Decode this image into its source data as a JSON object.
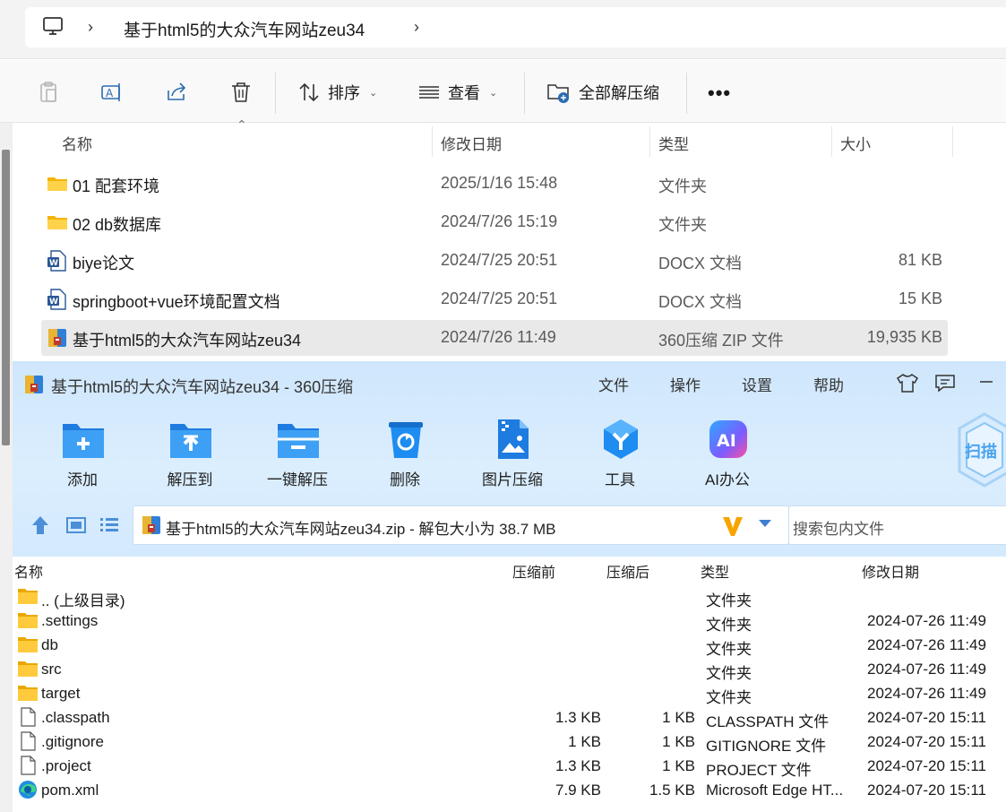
{
  "explorer": {
    "breadcrumb": {
      "computer_icon": "computer-icon",
      "path": "基于html5的大众汽车网站zeu34"
    },
    "toolbar": {
      "sort_label": "排序",
      "view_label": "查看",
      "extract_all_label": "全部解压缩"
    },
    "columns": {
      "name": "名称",
      "modified": "修改日期",
      "type": "类型",
      "size": "大小"
    },
    "files": [
      {
        "icon": "folder-icon",
        "name": "01 配套环境",
        "modified": "2025/1/16 15:48",
        "type": "文件夹",
        "size": ""
      },
      {
        "icon": "folder-icon",
        "name": "02 db数据库",
        "modified": "2024/7/26 15:19",
        "type": "文件夹",
        "size": ""
      },
      {
        "icon": "word-doc-icon",
        "name": "biye论文",
        "modified": "2024/7/25 20:51",
        "type": "DOCX 文档",
        "size": "81 KB"
      },
      {
        "icon": "word-doc-icon",
        "name": "springboot+vue环境配置文档",
        "modified": "2024/7/25 20:51",
        "type": "DOCX 文档",
        "size": "15 KB"
      },
      {
        "icon": "zip-archive-icon",
        "name": "基于html5的大众汽车网站zeu34",
        "modified": "2024/7/26 11:49",
        "type": "360压缩 ZIP 文件",
        "size": "19,935 KB",
        "selected": true
      }
    ]
  },
  "zip": {
    "title": "基于html5的大众汽车网站zeu34 - 360压缩",
    "menu": [
      "文件",
      "操作",
      "设置",
      "帮助"
    ],
    "tools": [
      {
        "icon": "add-icon",
        "label": "添加"
      },
      {
        "icon": "extract-to-icon",
        "label": "解压到"
      },
      {
        "icon": "one-click-extract-icon",
        "label": "一键解压"
      },
      {
        "icon": "delete-icon",
        "label": "删除"
      },
      {
        "icon": "image-compress-icon",
        "label": "图片压缩"
      },
      {
        "icon": "tools-icon",
        "label": "工具"
      },
      {
        "icon": "ai-office-icon",
        "label": "AI办公"
      }
    ],
    "scan_label": "扫描",
    "path_text": "基于html5的大众汽车网站zeu34.zip - 解包大小为 38.7 MB",
    "search_placeholder": "搜索包内文件",
    "columns": {
      "name": "名称",
      "before": "压缩前",
      "after": "压缩后",
      "type": "类型",
      "modified": "修改日期"
    },
    "entries": [
      {
        "icon": "folder-icon",
        "name": ".. (上级目录)",
        "before": "",
        "after": "",
        "type": "文件夹",
        "modified": ""
      },
      {
        "icon": "folder-icon",
        "name": ".settings",
        "before": "",
        "after": "",
        "type": "文件夹",
        "modified": "2024-07-26 11:49"
      },
      {
        "icon": "folder-icon",
        "name": "db",
        "before": "",
        "after": "",
        "type": "文件夹",
        "modified": "2024-07-26 11:49"
      },
      {
        "icon": "folder-icon",
        "name": "src",
        "before": "",
        "after": "",
        "type": "文件夹",
        "modified": "2024-07-26 11:49"
      },
      {
        "icon": "folder-icon",
        "name": "target",
        "before": "",
        "after": "",
        "type": "文件夹",
        "modified": "2024-07-26 11:49"
      },
      {
        "icon": "file-icon",
        "name": ".classpath",
        "before": "1.3 KB",
        "after": "1 KB",
        "type": "CLASSPATH 文件",
        "modified": "2024-07-20 15:11"
      },
      {
        "icon": "file-icon",
        "name": ".gitignore",
        "before": "1 KB",
        "after": "1 KB",
        "type": "GITIGNORE 文件",
        "modified": "2024-07-20 15:11"
      },
      {
        "icon": "file-icon",
        "name": ".project",
        "before": "1.3 KB",
        "after": "1 KB",
        "type": "PROJECT 文件",
        "modified": "2024-07-20 15:11"
      },
      {
        "icon": "edge-icon",
        "name": "pom.xml",
        "before": "7.9 KB",
        "after": "1.5 KB",
        "type": "Microsoft Edge HT...",
        "modified": "2024-07-20 15:11"
      }
    ]
  }
}
